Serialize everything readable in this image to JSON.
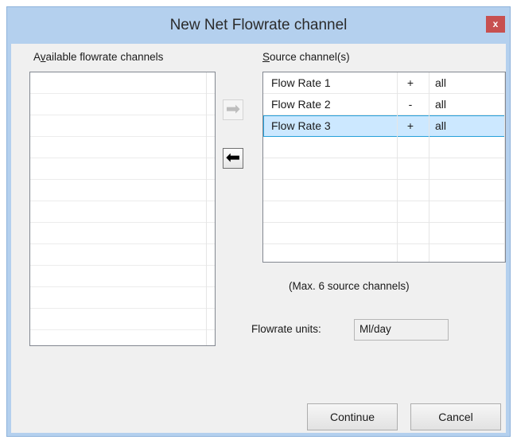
{
  "window": {
    "title": "New Net Flowrate channel",
    "close_icon": "close-icon",
    "close_glyph": "x"
  },
  "available": {
    "label_prefix": "A",
    "label_access_key": "v",
    "label_rest": "ailable flowrate channels",
    "items": []
  },
  "source": {
    "label_access_key": "S",
    "label_rest": "ource channel(s)",
    "rows": [
      {
        "name": "Flow Rate 1",
        "sign": "+",
        "scope": "all",
        "selected": false
      },
      {
        "name": "Flow Rate 2",
        "sign": "-",
        "scope": "all",
        "selected": false
      },
      {
        "name": "Flow Rate 3",
        "sign": "+",
        "scope": "all",
        "selected": true
      }
    ],
    "note": "(Max. 6 source channels)"
  },
  "arrows": {
    "add": {
      "icon": "arrow-right-icon",
      "glyph": "➡",
      "enabled": false
    },
    "remove": {
      "icon": "arrow-left-icon",
      "glyph": "⬅",
      "enabled": true
    }
  },
  "units": {
    "label": "Flowrate units:",
    "value": "Ml/day"
  },
  "buttons": {
    "continue": "Continue",
    "cancel": "Cancel"
  }
}
